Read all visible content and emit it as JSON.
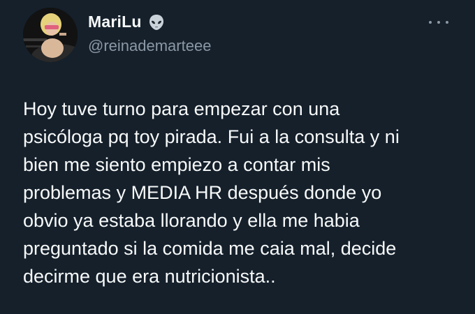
{
  "author": {
    "display_name": "MariLu",
    "handle": "@reinademarteee",
    "badge_icon": "alien-emoji-icon",
    "avatar_icon": "profile-photo"
  },
  "more_menu": {
    "icon": "more-options-icon"
  },
  "tweet": {
    "text": "Hoy tuve turno para empezar con una\npsicóloga pq toy pirada. Fui a la consulta y ni\nbien me siento empiezo a contar mis\nproblemas y MEDIA HR después donde yo\nobvio ya estaba llorando y ella me habia\npreguntado si la comida me caia mal, decide\ndecirme que era nutricionista.."
  },
  "colors": {
    "background": "#15202b",
    "primary_text": "#f7f9f9",
    "secondary_text": "#8b98a5"
  }
}
